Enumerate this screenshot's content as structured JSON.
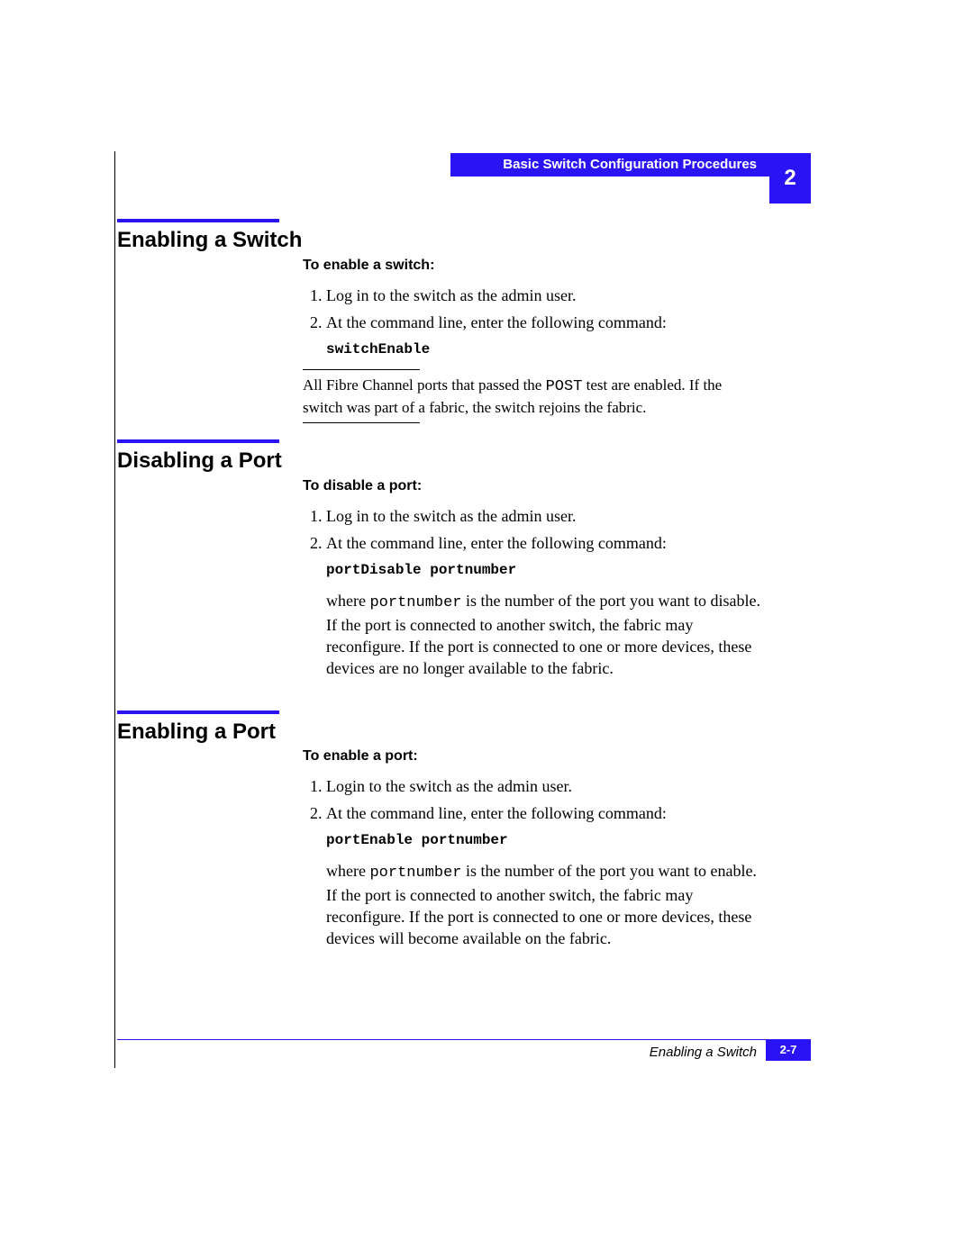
{
  "header": {
    "running_title": "Basic Switch Configuration Procedures",
    "chapter_tab": "2"
  },
  "sections": [
    {
      "title": "Enabling a Switch",
      "subhead": "To enable a switch:",
      "steps": [
        "Log in to the switch as the admin user.",
        "At the command line, enter the following command:"
      ],
      "command": "switchEnable",
      "note_prefix": "All Fibre Channel ports that passed the ",
      "note_code": "POST",
      "note_suffix": " test are enabled. If the switch was part of a fabric, the switch rejoins the fabric."
    },
    {
      "title": "Disabling a Port",
      "subhead": "To disable a port:",
      "steps": [
        "Log in to the switch as the admin user.",
        "At the command line, enter the following command:"
      ],
      "command": "portDisable portnumber",
      "para_prefix": "where ",
      "para_code": "portnumber",
      "para_suffix": " is the number of the port you want to disable. If the port is connected to another switch, the fabric may reconfigure. If the port is connected to one or more devices, these devices are no longer available to the fabric."
    },
    {
      "title": "Enabling a Port",
      "subhead": "To enable a port:",
      "steps": [
        "Login to the switch as the admin user.",
        "At the command line, enter the following command:"
      ],
      "command": "portEnable portnumber",
      "para_prefix": "where ",
      "para_code": "portnumber",
      "para_suffix": " is the number of the port you want to enable. If the port is connected to another switch, the fabric may reconfigure. If the port is connected to one or more devices, these devices will become available on the fabric."
    }
  ],
  "footer": {
    "caption": "Enabling a Switch",
    "page": "2-7"
  }
}
